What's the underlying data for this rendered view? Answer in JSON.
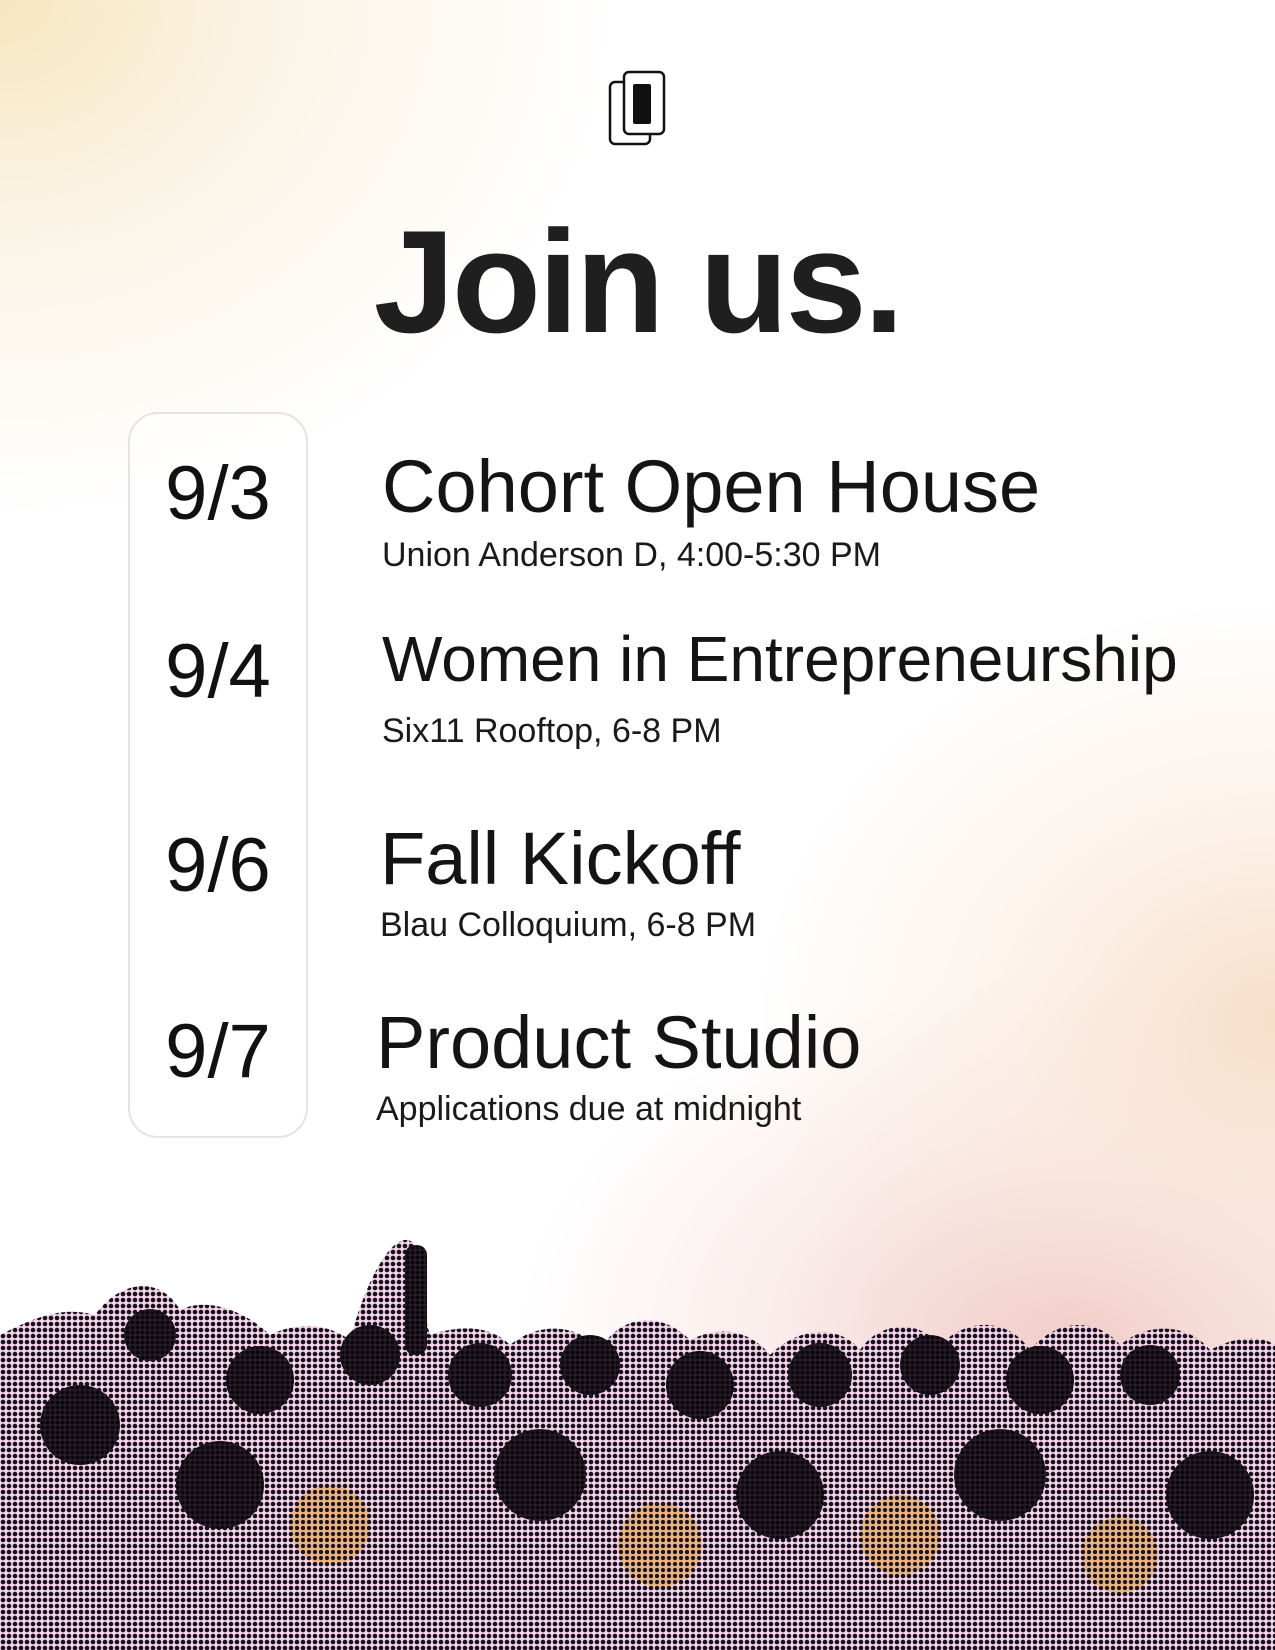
{
  "headline": "Join us.",
  "logo": {
    "icon": "stacked-cards-logo"
  },
  "events": [
    {
      "date": "9/3",
      "title": "Cohort Open House",
      "details": "Union Anderson D, 4:00-5:30 PM"
    },
    {
      "date": "9/4",
      "title": "Women in Entrepreneurship",
      "details": "Six11 Rooftop, 6-8 PM"
    },
    {
      "date": "9/6",
      "title": "Fall Kickoff",
      "details": "Blau Colloquium, 6-8 PM"
    },
    {
      "date": "9/7",
      "title": "Product Studio",
      "details": "Applications due at midnight"
    }
  ],
  "colors": {
    "warm_glow": "#f7e6bf",
    "pink_glow": "#f0c9c6",
    "text": "#151515",
    "pill_border": "#e6e3e3"
  }
}
